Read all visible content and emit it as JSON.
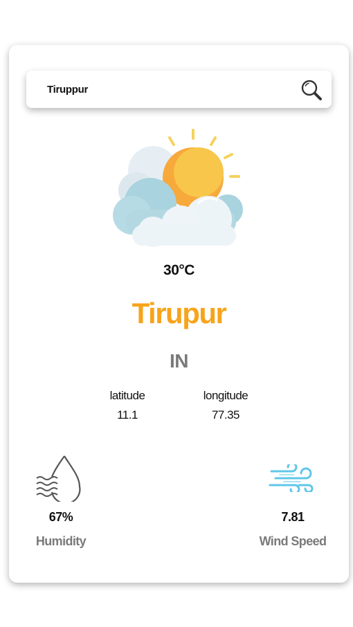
{
  "search": {
    "value": "Tiruppur",
    "icon": "search-icon"
  },
  "weather": {
    "icon": "partly-cloudy-sun-icon",
    "temperature": "30°C",
    "city": "Tirupur",
    "country": "IN"
  },
  "coordinates": {
    "latitude_label": "latitude",
    "latitude_value": "11.1",
    "longitude_label": "longitude",
    "longitude_value": "77.35"
  },
  "stats": {
    "humidity": {
      "icon": "humidity-drop-icon",
      "value": "67%",
      "label": "Humidity"
    },
    "wind": {
      "icon": "wind-icon",
      "value": "7.81",
      "label": "Wind Speed"
    }
  },
  "colors": {
    "accent": "#f7a41b",
    "muted": "#7a7a7a"
  }
}
